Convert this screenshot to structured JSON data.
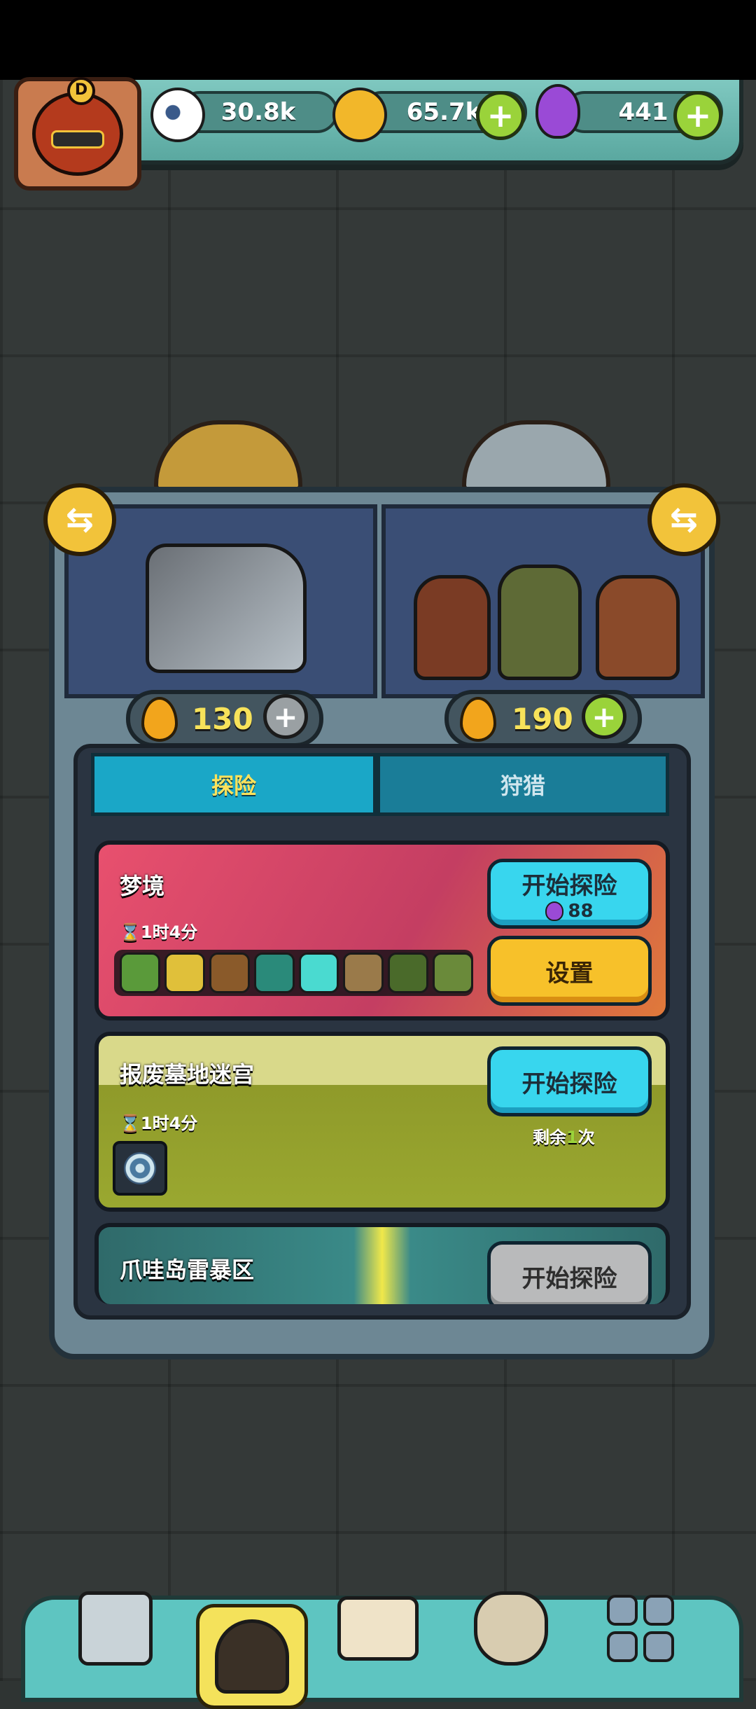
{
  "resources": {
    "eyeball": {
      "value": "30.8k",
      "icon": "eyeball-icon"
    },
    "coins": {
      "value": "65.7k",
      "icon": "coin-icon"
    },
    "potion": {
      "value": "441",
      "icon": "potion-icon"
    }
  },
  "avatar": {
    "badge": "D"
  },
  "fuel": [
    {
      "value": "130",
      "plus_style": "gray"
    },
    {
      "value": "190",
      "plus_style": "green"
    }
  ],
  "tabs": [
    {
      "label": "探险",
      "active": true
    },
    {
      "label": "狩猎",
      "active": false
    }
  ],
  "expeditions": [
    {
      "title": "梦境",
      "time": "1时4分",
      "start_label": "开始探险",
      "cost": "88",
      "settings_label": "设置"
    },
    {
      "title": "报废墓地迷宫",
      "time": "1时4分",
      "start_label": "开始探险",
      "remaining_prefix": "剩余",
      "remaining_count": "1",
      "remaining_suffix": "次"
    },
    {
      "title": "爪哇岛雷暴区",
      "start_label": "开始探险"
    }
  ],
  "colors": {
    "accent_cyan": "#38d6ee",
    "accent_yellow": "#f7c12a",
    "accent_green": "#9ad33a",
    "disabled_gray": "#b9babb"
  },
  "nav": [
    {
      "name": "shop",
      "icon": "shop-building-icon"
    },
    {
      "name": "expedition",
      "icon": "expedition-creature-icon",
      "active": true
    },
    {
      "name": "book",
      "icon": "book-icon"
    },
    {
      "name": "money-bag",
      "icon": "money-bag-icon"
    },
    {
      "name": "menu",
      "icon": "grid-menu-icon"
    }
  ]
}
